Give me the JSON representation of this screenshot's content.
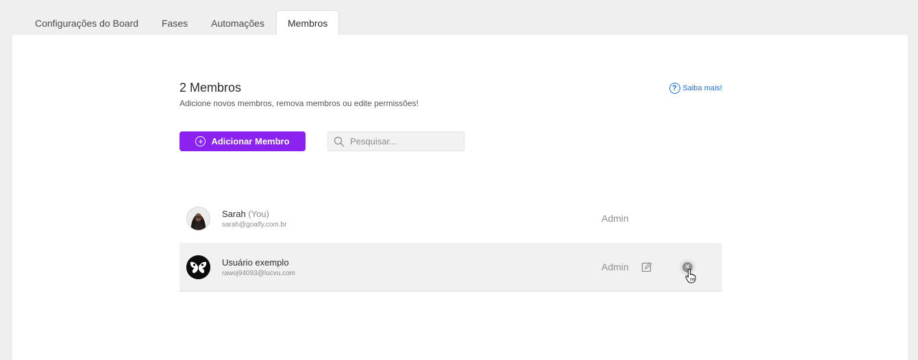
{
  "tabs": [
    {
      "label": "Configurações do Board",
      "active": false
    },
    {
      "label": "Fases",
      "active": false
    },
    {
      "label": "Automações",
      "active": false
    },
    {
      "label": "Membros",
      "active": true
    }
  ],
  "header": {
    "title": "2 Membros",
    "subtitle": "Adicione novos membros, remova membros ou edite permissões!",
    "help_label": "Saiba mais!",
    "help_icon": "question-circle-icon"
  },
  "toolbar": {
    "add_label": "Adicionar Membro",
    "add_icon": "plus-circle-icon",
    "search_placeholder": "Pesquisar...",
    "search_value": ""
  },
  "members": [
    {
      "name": "Sarah",
      "tag": "(You)",
      "email": "sarah@goalfy.com.br",
      "role": "Admin",
      "avatar": "person-photo"
    },
    {
      "name": "Usuário exemplo",
      "tag": "",
      "email": "rawoj94093@lucvu.com",
      "role": "Admin",
      "avatar": "butterfly-logo"
    }
  ],
  "colors": {
    "accent": "#8b22f0",
    "link": "#1a6fd6",
    "background": "#efefef",
    "panel": "#ffffff"
  }
}
